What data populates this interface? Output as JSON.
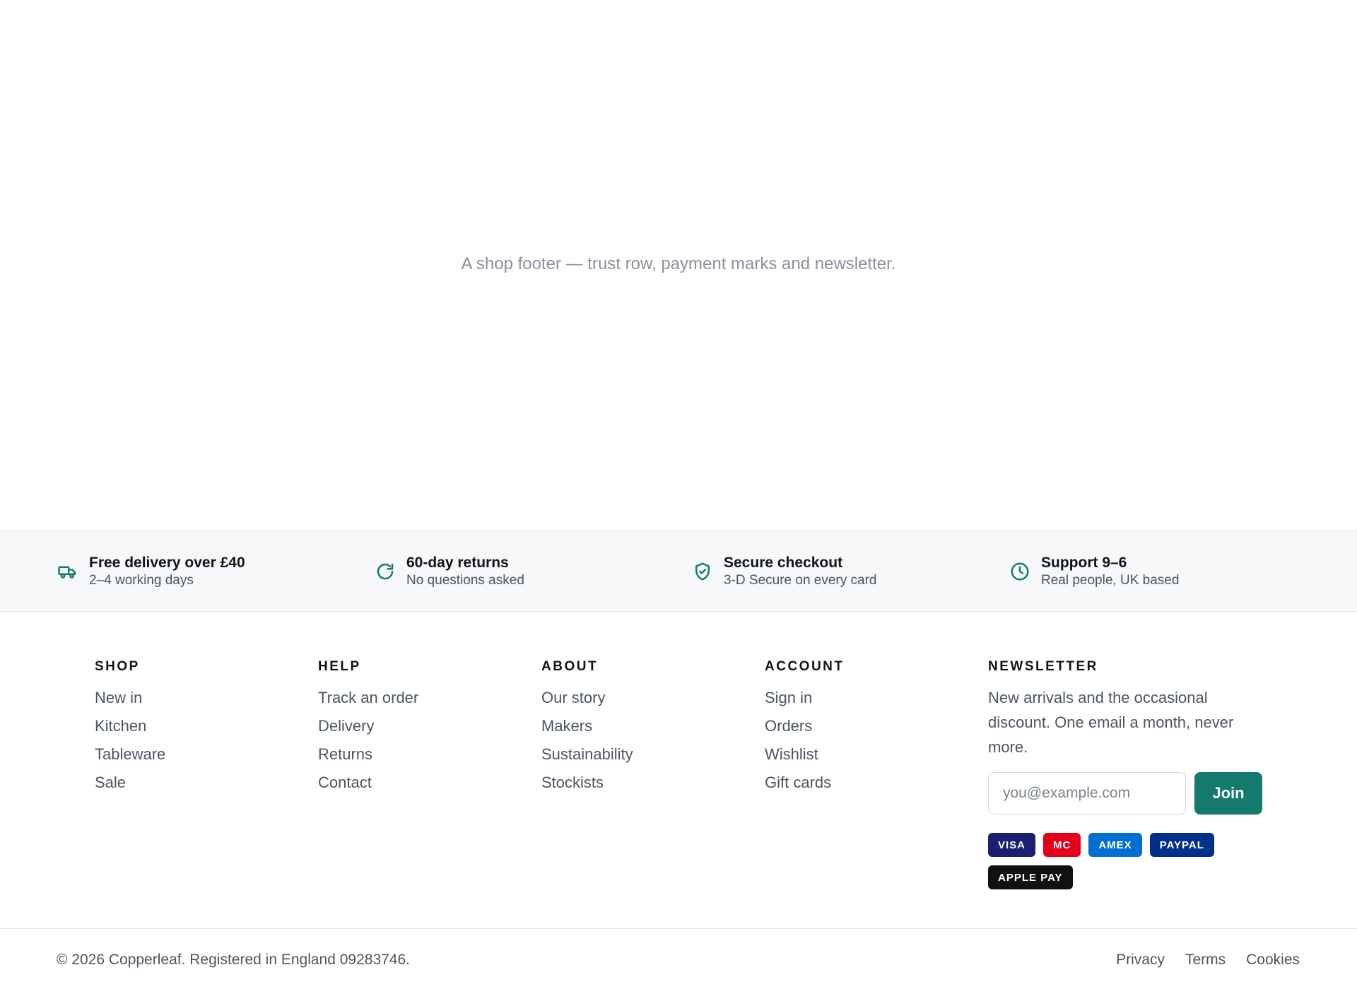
{
  "hero": {
    "caption": "A shop footer — trust row, payment marks and newsletter."
  },
  "trust": {
    "accent": "#157a6e",
    "items": [
      {
        "icon": "truck-icon",
        "title": "Free delivery over £40",
        "subtitle": "2–4 working days"
      },
      {
        "icon": "refresh-icon",
        "title": "60-day returns",
        "subtitle": "No questions asked"
      },
      {
        "icon": "shield-check-icon",
        "title": "Secure checkout",
        "subtitle": "3-D Secure on every card"
      },
      {
        "icon": "clock-icon",
        "title": "Support 9–6",
        "subtitle": "Real people, UK based"
      }
    ]
  },
  "columns": [
    {
      "heading": "SHOP",
      "links": [
        "New in",
        "Kitchen",
        "Tableware",
        "Sale"
      ]
    },
    {
      "heading": "HELP",
      "links": [
        "Track an order",
        "Delivery",
        "Returns",
        "Contact"
      ]
    },
    {
      "heading": "ABOUT",
      "links": [
        "Our story",
        "Makers",
        "Sustainability",
        "Stockists"
      ]
    },
    {
      "heading": "ACCOUNT",
      "links": [
        "Sign in",
        "Orders",
        "Wishlist",
        "Gift cards"
      ]
    }
  ],
  "newsletter": {
    "heading": "NEWSLETTER",
    "text": "New arrivals and the occasional discount. One email a month, never more.",
    "placeholder": "you@example.com",
    "button": "Join"
  },
  "payments": [
    {
      "label": "VISA",
      "color": "#1a1f71"
    },
    {
      "label": "MC",
      "color": "#e4001b"
    },
    {
      "label": "AMEX",
      "color": "#006fcf"
    },
    {
      "label": "PAYPAL",
      "color": "#003087"
    },
    {
      "label": "APPLE PAY",
      "color": "#111111"
    }
  ],
  "bottom": {
    "copyright": "© 2026 Copperleaf. Registered in England 09283746.",
    "links": [
      "Privacy",
      "Terms",
      "Cookies"
    ]
  }
}
